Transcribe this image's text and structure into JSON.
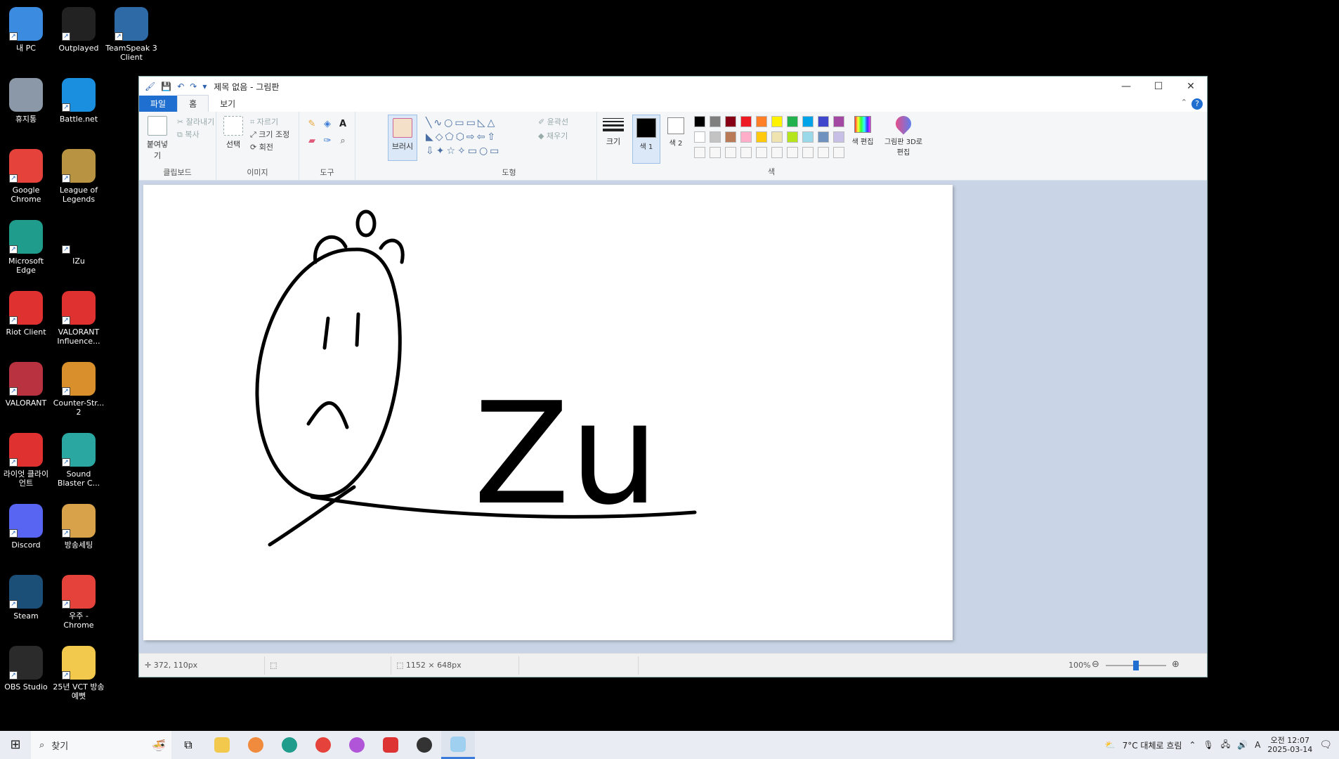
{
  "desktop": {
    "icons": [
      {
        "label": "내 PC",
        "color": "#3b8be0"
      },
      {
        "label": "Outplayed",
        "color": "#222"
      },
      {
        "label": "TeamSpeak 3 Client",
        "color": "#2e6aa5"
      },
      {
        "label": "휴지통",
        "color": "#8a98a8"
      },
      {
        "label": "Battle.net",
        "color": "#1a8fe0"
      },
      {
        "label": "Google Chrome",
        "color": "#e4423a"
      },
      {
        "label": "League of Legends",
        "color": "#b89442"
      },
      {
        "label": "Microsoft Edge",
        "color": "#1f9c8c"
      },
      {
        "label": "IZu",
        "color": "#000"
      },
      {
        "label": "Riot Client",
        "color": "#e03131"
      },
      {
        "label": "VALORANT Influence...",
        "color": "#e03131"
      },
      {
        "label": "VALORANT",
        "color": "#b83240"
      },
      {
        "label": "Counter-Str... 2",
        "color": "#d98f2c"
      },
      {
        "label": "라이엇 클라이언트",
        "color": "#e03131"
      },
      {
        "label": "Sound Blaster C...",
        "color": "#2aa7a0"
      },
      {
        "label": "Discord",
        "color": "#5865f2"
      },
      {
        "label": "방송세팅",
        "color": "#d8a24a"
      },
      {
        "label": "Steam",
        "color": "#1b4f78"
      },
      {
        "label": "우주 - Chrome",
        "color": "#e4423a"
      },
      {
        "label": "OBS Studio",
        "color": "#2b2b2b"
      },
      {
        "label": "25년 VCT 방송 예뻣",
        "color": "#f2c94c"
      }
    ]
  },
  "paint": {
    "title": "제목 없음 - 그림판",
    "tabs": {
      "file": "파일",
      "home": "홈",
      "view": "보기"
    },
    "help": "?",
    "clipboard": {
      "paste": "붙여넣기",
      "cut": "잘라내기",
      "copy": "복사",
      "group": "클립보드"
    },
    "image": {
      "select": "선택",
      "crop": "자르기",
      "resize": "크기 조정",
      "rotate": "회전",
      "group": "이미지"
    },
    "tools": {
      "group": "도구",
      "text": "A"
    },
    "brushes": {
      "label": "브러시"
    },
    "shapes": {
      "outline": "윤곽선",
      "fill": "채우기",
      "group": "도형"
    },
    "size": {
      "label": "크기"
    },
    "colors": {
      "color1": "색 1",
      "color2": "색 2",
      "edit": "색 편집",
      "paint3d": "그림판 3D로 편집",
      "group": "색",
      "palette_row1": [
        "#000000",
        "#7f7f7f",
        "#880015",
        "#ed1c24",
        "#ff7f27",
        "#fff200",
        "#22b14c",
        "#00a2e8",
        "#3f48cc",
        "#a349a4"
      ],
      "palette_row2": [
        "#ffffff",
        "#c3c3c3",
        "#b97a57",
        "#ffaec9",
        "#ffc90e",
        "#efe4b0",
        "#b5e61d",
        "#99d9ea",
        "#7092be",
        "#c8bfe7"
      ]
    },
    "drawing": {
      "text": "Zu"
    },
    "status": {
      "cursor": "372, 110px",
      "canvas_size": "1152 × 648px",
      "zoom": "100%",
      "zoom_fraction": 0.5
    }
  },
  "taskbar": {
    "search_placeholder": "찾기",
    "weather": "7°C 대체로 흐림",
    "time": "오전 12:07",
    "date": "2025-03-14",
    "ime": "A"
  }
}
